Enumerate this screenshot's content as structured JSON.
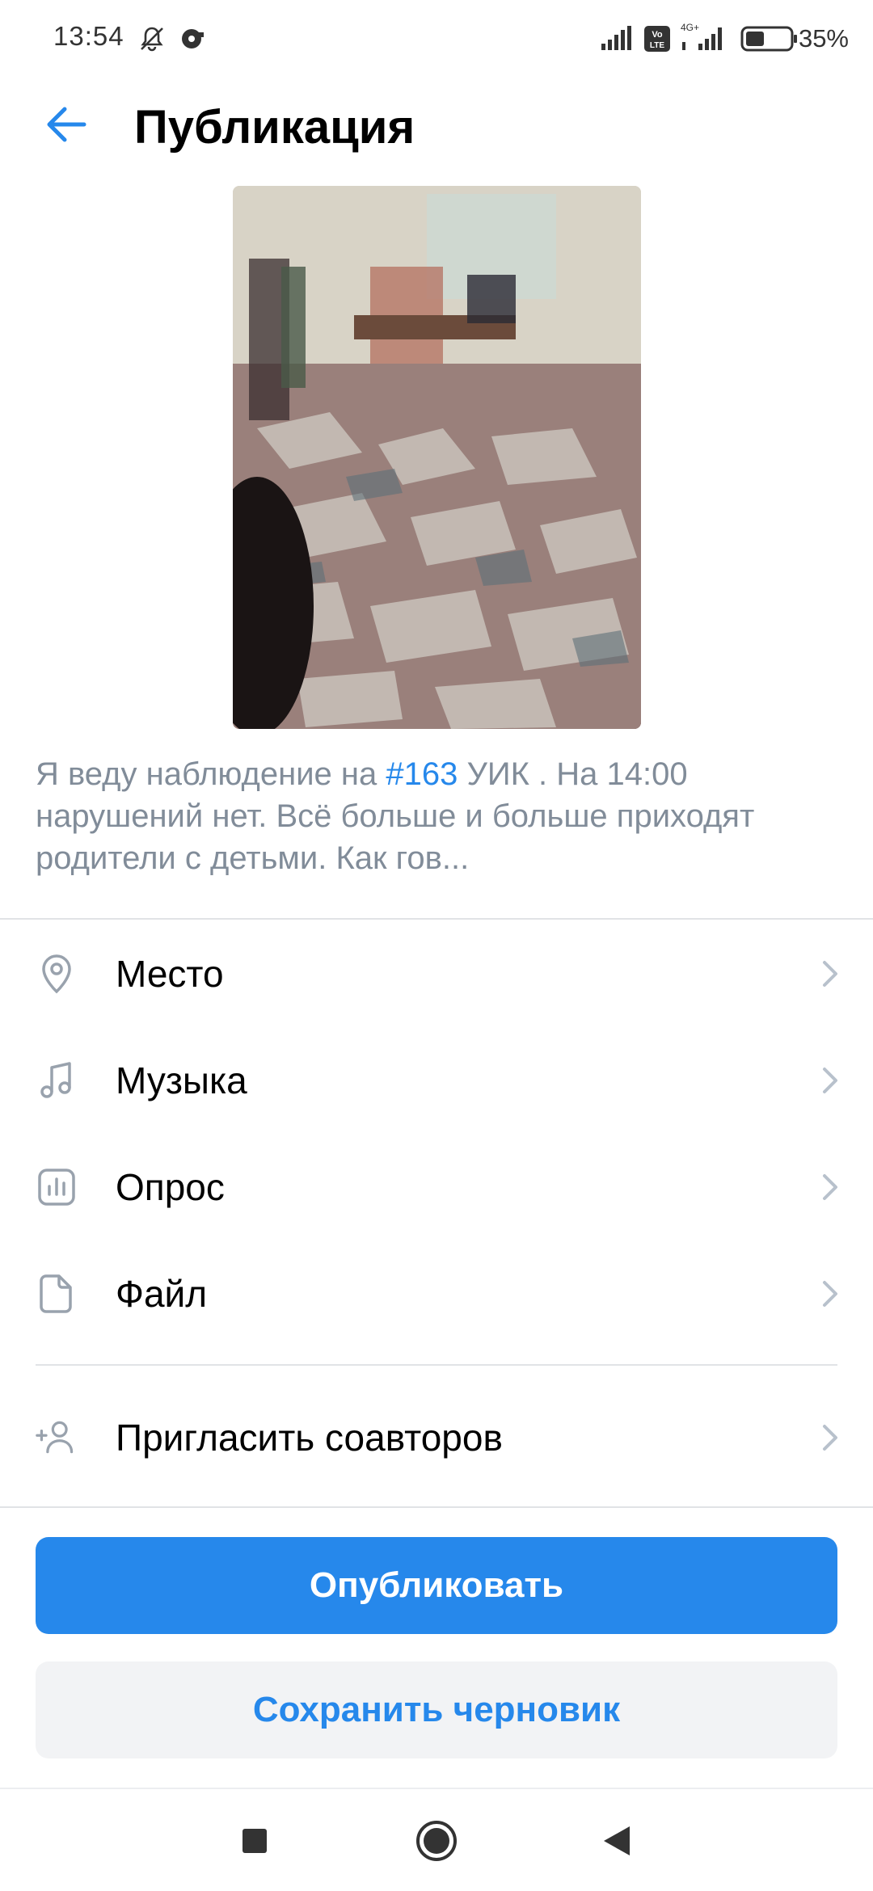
{
  "status_bar": {
    "time": "13:54",
    "battery": "35%",
    "network_badge": "Vo LTE",
    "network_type": "4G+"
  },
  "header": {
    "title": "Публикация"
  },
  "post": {
    "text_before": "Я веду наблюдение на ",
    "hashtag": "#163",
    "text_after": " УИК . На 14:00 нарушений нет. Всё больше и больше приходят родители с детьми. Как гов..."
  },
  "menu": {
    "items": [
      {
        "label": "Место",
        "icon": "location-pin-icon"
      },
      {
        "label": "Музыка",
        "icon": "music-note-icon"
      },
      {
        "label": "Опрос",
        "icon": "poll-icon"
      },
      {
        "label": "Файл",
        "icon": "file-icon"
      }
    ],
    "invite": {
      "label": "Пригласить соавторов",
      "icon": "add-person-icon"
    }
  },
  "buttons": {
    "publish": "Опубликовать",
    "save_draft": "Сохранить черновик"
  },
  "colors": {
    "accent": "#2688eb",
    "secondary_bg": "#f2f3f5",
    "muted_text": "#818c99",
    "icon_gray": "#99a2ad"
  }
}
